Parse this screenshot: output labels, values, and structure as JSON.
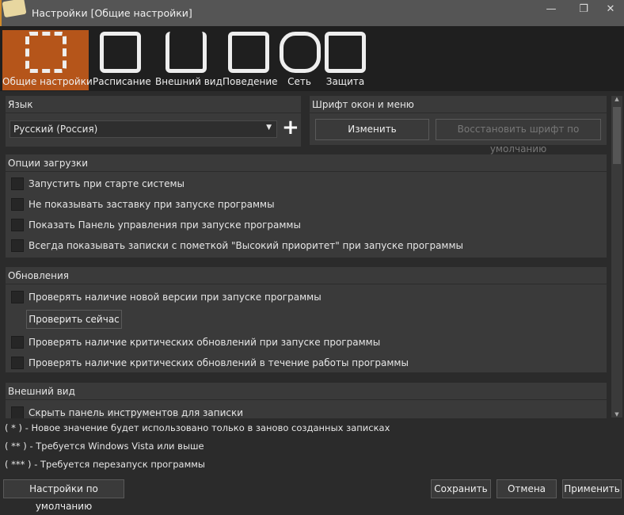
{
  "window": {
    "title": "Настройки [Общие настройки]",
    "controls": [
      "—",
      "❐",
      "✕"
    ]
  },
  "toolbar": {
    "items": [
      {
        "label": "Общие настройки",
        "icon": "tools-icon",
        "selected": true
      },
      {
        "label": "Расписание",
        "icon": "calendar-clock-icon"
      },
      {
        "label": "Внешний вид",
        "icon": "brush-cup-icon"
      },
      {
        "label": "Поведение",
        "icon": "monitor-user-icon"
      },
      {
        "label": "Сеть",
        "icon": "network-users-icon"
      },
      {
        "label": "Защита",
        "icon": "safe-icon"
      }
    ]
  },
  "language": {
    "header": "Язык",
    "value": "Русский (Россия)",
    "add": "+"
  },
  "font": {
    "header": "Шрифт окон и меню",
    "change": "Изменить",
    "restore": "Восстановить шрифт по умолчанию"
  },
  "startup": {
    "header": "Опции загрузки",
    "options": [
      "Запустить при старте системы",
      "Не показывать заставку при запуске программы",
      "Показать Панель управления при запуске программы",
      "Всегда показывать записки с пометкой \"Высокий приоритет\" при запуске программы"
    ]
  },
  "updates": {
    "header": "Обновления",
    "check_new": "Проверять наличие новой версии при запуске программы",
    "check_now": "Проверить сейчас",
    "critical_start": "Проверять наличие критических обновлений при запуске программы",
    "critical_run": "Проверять наличие критических обновлений в течение работы программы"
  },
  "appearance": {
    "header": "Внешний вид",
    "hide_toolbar": "Скрыть панель инструментов для записки"
  },
  "notes": [
    "( * ) - Новое значение будет использовано только в заново созданных записках",
    "( ** ) - Требуется Windows Vista или выше",
    "( *** ) - Требуется перезапуск программы"
  ],
  "footer": {
    "defaults": "Настройки по умолчанию",
    "save": "Сохранить",
    "cancel": "Отмена",
    "apply": "Применить"
  },
  "colors": {
    "accent": "#b5551a"
  }
}
